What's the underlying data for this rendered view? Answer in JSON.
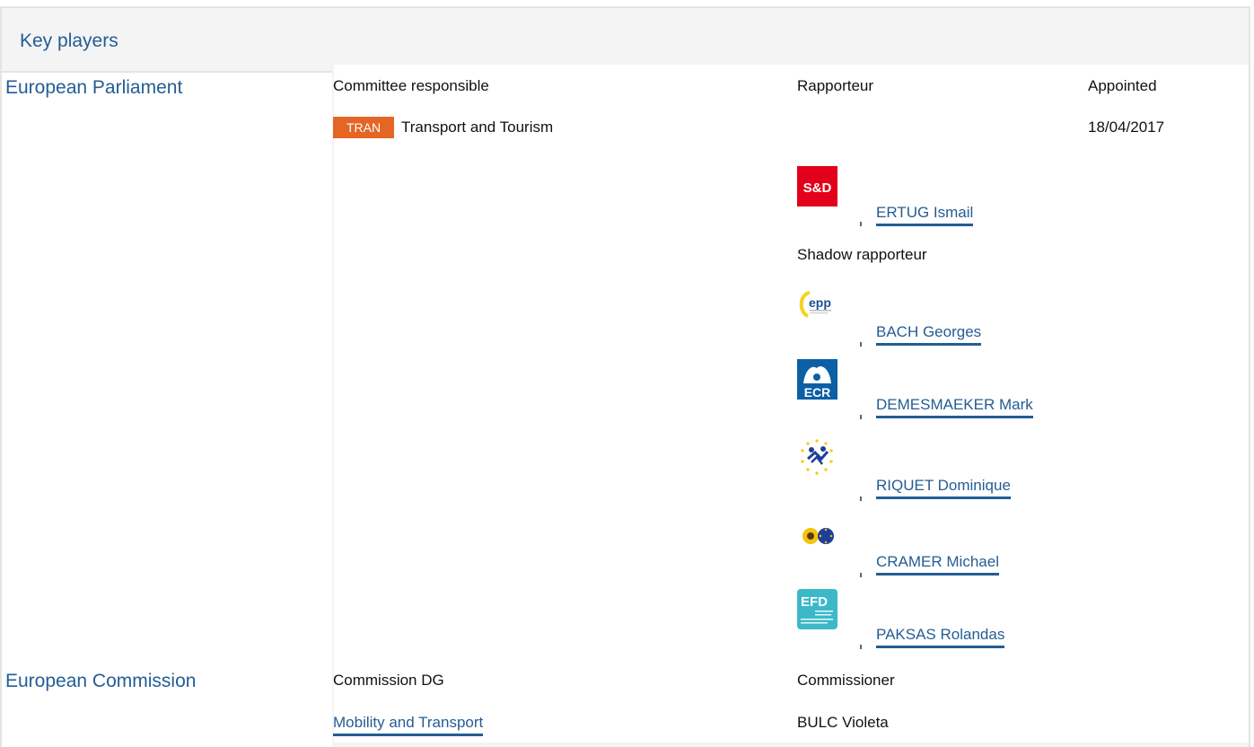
{
  "section": {
    "title": "Key players"
  },
  "parliament": {
    "institution": "European Parliament",
    "headers": {
      "committee": "Committee responsible",
      "rapporteur": "Rapporteur",
      "appointed": "Appointed"
    },
    "committee": {
      "code": "TRAN",
      "name": "Transport and Tourism",
      "appointed": "18/04/2017"
    },
    "rapporteur": {
      "group_logo_text": "S&D",
      "name": "ERTUG Ismail",
      "group_icon": "sd-group-logo"
    },
    "shadow_label": "Shadow rapporteur",
    "shadows": [
      {
        "name": "BACH Georges",
        "group_icon": "epp-group-logo",
        "logo_text": "epp"
      },
      {
        "name": "DEMESMAEKER Mark",
        "group_icon": "ecr-group-logo",
        "logo_text": "ECR"
      },
      {
        "name": "RIQUET Dominique",
        "group_icon": "alde-group-logo"
      },
      {
        "name": "CRAMER Michael",
        "group_icon": "greens-efa-group-logo"
      },
      {
        "name": "PAKSAS Rolandas",
        "group_icon": "efdd-group-logo",
        "logo_text": "EFD"
      }
    ]
  },
  "commission": {
    "institution": "European Commission",
    "headers": {
      "dg": "Commission DG",
      "commissioner": "Commissioner"
    },
    "dg": "Mobility and Transport",
    "commissioner": "BULC Violeta"
  },
  "colors": {
    "link": "#245d94",
    "badge": "#e56624",
    "sd_red": "#e2001a",
    "ecr_blue": "#0b5fa5",
    "efdd_teal": "#3cb8c9",
    "header_bg": "#f4f4f4",
    "border": "#e4e4e4"
  }
}
